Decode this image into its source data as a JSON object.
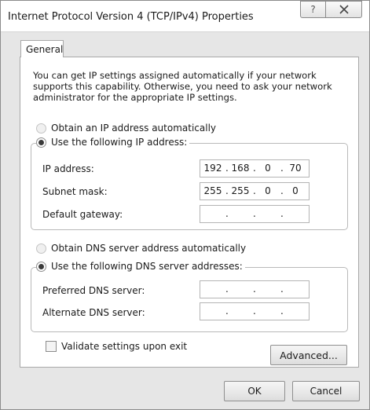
{
  "window": {
    "title": "Internet Protocol Version 4 (TCP/IPv4) Properties",
    "help_glyph": "?",
    "close_glyph": "X"
  },
  "tabs": [
    {
      "label": "General",
      "selected": true
    }
  ],
  "description": "You can get IP settings assigned automatically if your network supports this capability. Otherwise, you need to ask your network administrator for the appropriate IP settings.",
  "ip_section": {
    "auto_label": "Obtain an IP address automatically",
    "auto_selected": false,
    "manual_label": "Use the following IP address:",
    "manual_selected": true,
    "fields": [
      {
        "label": "IP address:",
        "octets": [
          "192",
          "168",
          "0",
          "70"
        ]
      },
      {
        "label": "Subnet mask:",
        "octets": [
          "255",
          "255",
          "0",
          "0"
        ]
      },
      {
        "label": "Default gateway:",
        "octets": [
          "",
          "",
          "",
          ""
        ]
      }
    ]
  },
  "dns_section": {
    "auto_label": "Obtain DNS server address automatically",
    "auto_selected": false,
    "manual_label": "Use the following DNS server addresses:",
    "manual_selected": true,
    "fields": [
      {
        "label": "Preferred DNS server:",
        "octets": [
          "",
          "",
          "",
          ""
        ]
      },
      {
        "label": "Alternate DNS server:",
        "octets": [
          "",
          "",
          "",
          ""
        ]
      }
    ]
  },
  "validate": {
    "label": "Validate settings upon exit",
    "checked": false
  },
  "buttons": {
    "advanced": "Advanced...",
    "ok": "OK",
    "cancel": "Cancel"
  },
  "colors": {
    "window_bg": "#e6e6e6",
    "panel_bg": "#ffffff",
    "border": "#a8a8a8"
  }
}
